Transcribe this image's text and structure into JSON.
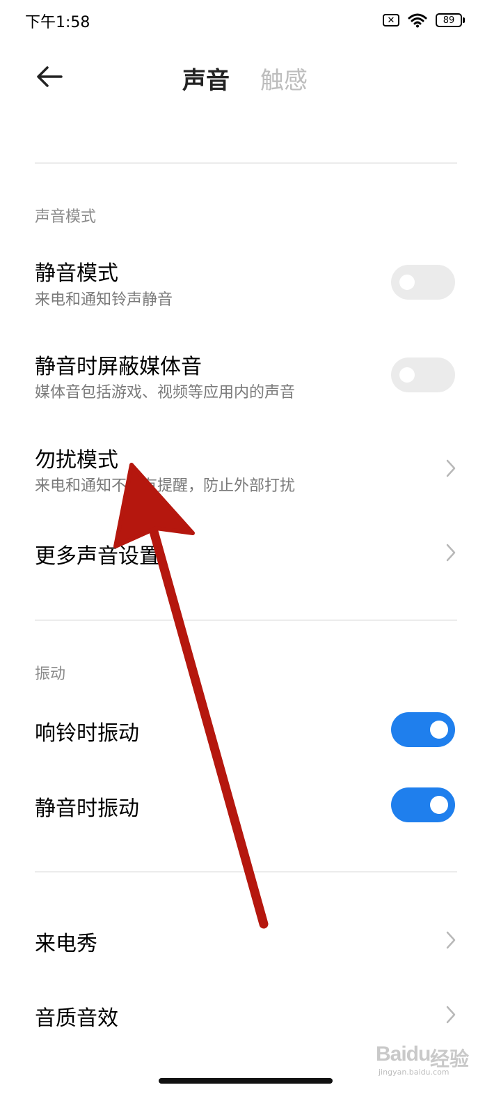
{
  "status_bar": {
    "time": "下午1:58",
    "sim_glyph": "✕",
    "battery": "89"
  },
  "header": {
    "back_icon": "back-arrow-icon",
    "tab_active": "声音",
    "tab_inactive": "触感"
  },
  "section_sound_mode": {
    "label": "声音模式",
    "rows": [
      {
        "title": "静音模式",
        "subtitle": "来电和通知铃声静音",
        "control": "toggle",
        "enabled": false
      },
      {
        "title": "静音时屏蔽媒体音",
        "subtitle": "媒体音包括游戏、视频等应用内的声音",
        "control": "toggle",
        "enabled": false
      },
      {
        "title": "勿扰模式",
        "subtitle": "来电和通知不会有提醒，防止外部打扰",
        "control": "chevron"
      },
      {
        "title": "更多声音设置",
        "control": "chevron"
      }
    ]
  },
  "section_vibration": {
    "label": "振动",
    "rows": [
      {
        "title": "响铃时振动",
        "control": "toggle",
        "enabled": true
      },
      {
        "title": "静音时振动",
        "control": "toggle",
        "enabled": true
      }
    ]
  },
  "section_other": {
    "rows": [
      {
        "title": "来电秀",
        "control": "chevron"
      },
      {
        "title": "音质音效",
        "control": "chevron"
      }
    ]
  },
  "annotation": {
    "type": "red-arrow",
    "points_to": "勿扰模式",
    "color": "#b5170e"
  },
  "watermark": {
    "name": "Baidu",
    "suffix": "经验",
    "site": "jingyan.baidu.com"
  },
  "colors": {
    "toggle_on": "#1f7fed",
    "toggle_off": "#ebebeb",
    "accent_arrow": "#b5170e"
  }
}
